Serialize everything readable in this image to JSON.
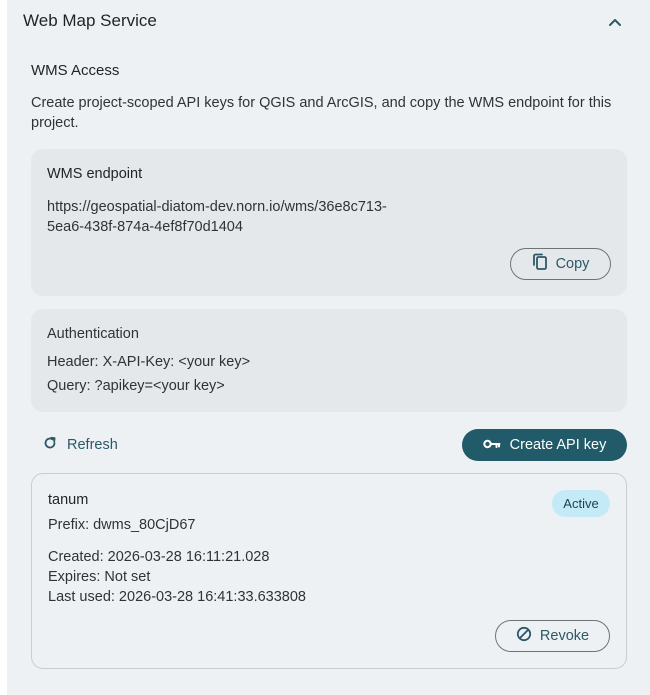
{
  "header": {
    "title": "Web Map Service",
    "collapse_icon": "chevron-up-icon"
  },
  "wms_access": {
    "title": "WMS Access",
    "description": "Create project-scoped API keys for QGIS and ArcGIS, and copy the WMS endpoint for this project."
  },
  "endpoint": {
    "heading": "WMS endpoint",
    "url": "https://geospatial-diatom-dev.norn.io/wms/36e8c713-5ea6-438f-874a-4ef8f70d1404",
    "copy_label": "Copy",
    "copy_icon": "copy-icon"
  },
  "auth": {
    "heading": "Authentication",
    "header_line": "Header: X-API-Key: <your key>",
    "query_line": "Query: ?apikey=<your key>"
  },
  "actions": {
    "refresh_label": "Refresh",
    "refresh_icon": "refresh-icon",
    "create_label": "Create API key",
    "create_icon": "key-icon"
  },
  "api_key": {
    "name": "tanum",
    "prefix": "Prefix: dwms_80CjD67",
    "status": "Active",
    "created": "Created: 2026-03-28 16:11:21.028",
    "expires": "Expires: Not set",
    "last_used": "Last used: 2026-03-28 16:41:33.633808",
    "revoke_label": "Revoke",
    "revoke_icon": "block-icon"
  },
  "colors": {
    "panel_bg": "#eef1f4",
    "card_bg": "#e5e8eb",
    "accent": "#215b69",
    "accent_text": "#2c5966",
    "badge_bg": "#c5eaf7"
  }
}
